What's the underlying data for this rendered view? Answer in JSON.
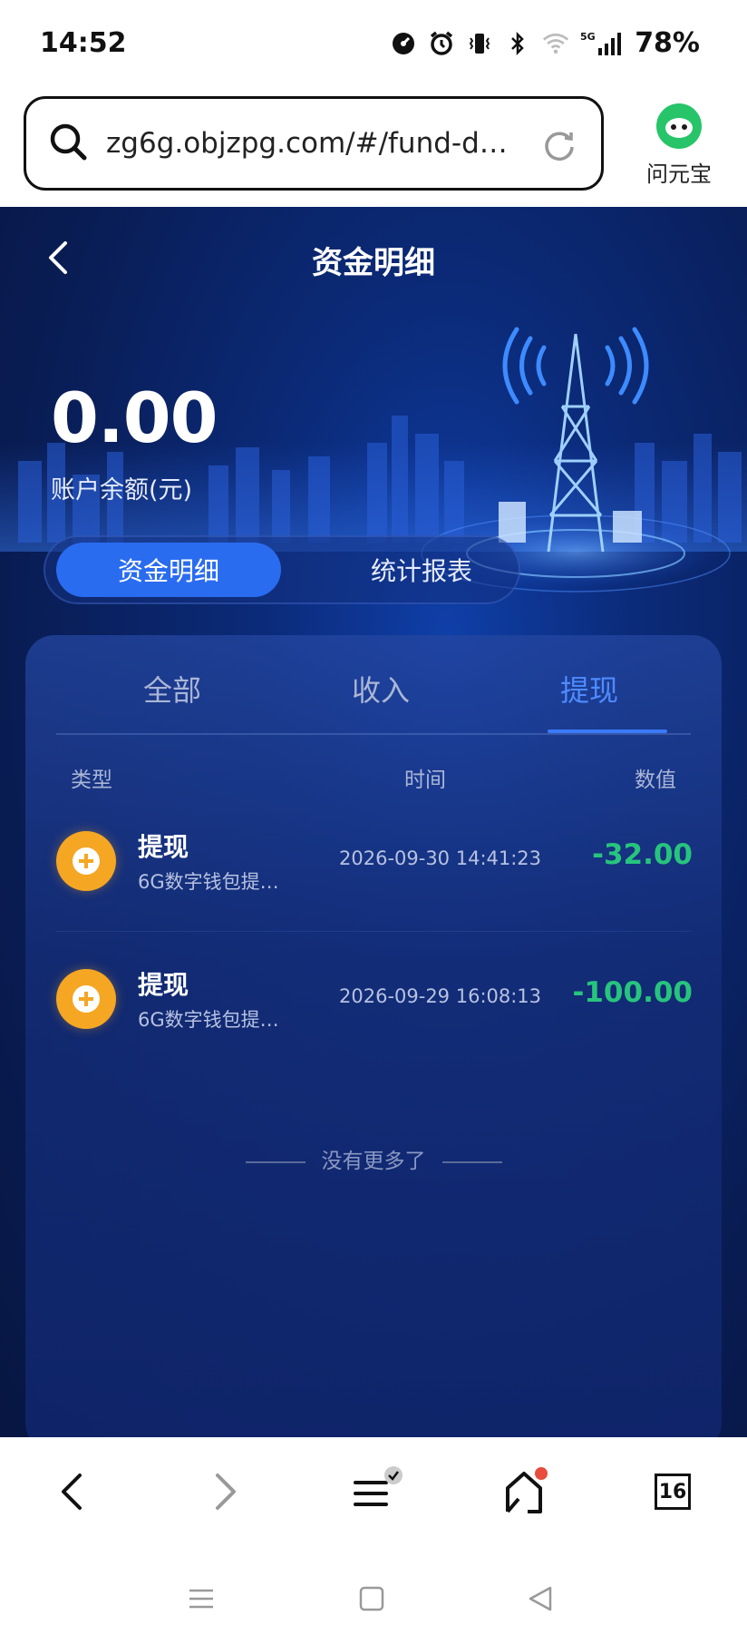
{
  "status_bar": {
    "time": "14:52",
    "network": "5G",
    "battery": "78%"
  },
  "browser": {
    "url": "zg6g.objzpg.com/#/fund-de...",
    "assistant_label": "问元宝",
    "tabs_count": "16"
  },
  "app": {
    "title": "资金明细",
    "balance": "0.00",
    "balance_label": "账户余额(元)",
    "segments": [
      "资金明细",
      "统计报表"
    ],
    "tabs": [
      "全部",
      "收入",
      "提现"
    ],
    "active_tab": "提现",
    "columns": {
      "type": "类型",
      "time": "时间",
      "value": "数值"
    },
    "records": [
      {
        "title": "提现",
        "subtitle": "6G数字钱包提现...",
        "time": "2026-09-30 14:41:23",
        "value": "-32.00"
      },
      {
        "title": "提现",
        "subtitle": "6G数字钱包提现...",
        "time": "2026-09-29 16:08:13",
        "value": "-100.00"
      }
    ],
    "no_more": "没有更多了"
  },
  "colors": {
    "accent": "#2a6cf0",
    "tab_active": "#4f8bff",
    "amount": "#27c47d",
    "coin": "#f5a623"
  }
}
